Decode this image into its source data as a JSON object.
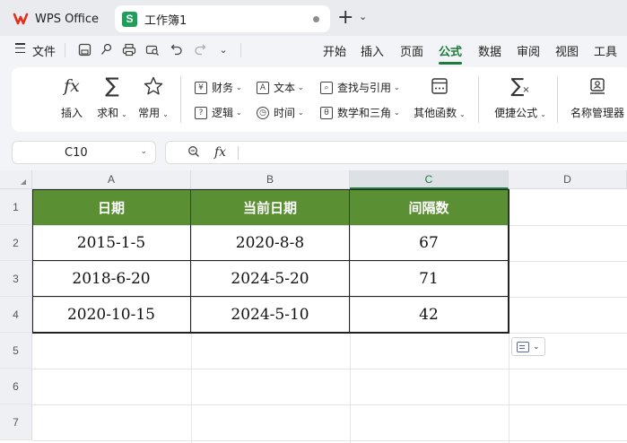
{
  "tabs": {
    "app_label": "WPS Office",
    "workbook_label": "工作簿1"
  },
  "menu": {
    "file_label": "文件",
    "ribbon_tabs": [
      "开始",
      "插入",
      "页面",
      "公式",
      "数据",
      "审阅",
      "视图",
      "工具"
    ],
    "active_tab": "公式"
  },
  "ribbon": {
    "insert_label": "插入",
    "sum_label": "求和",
    "common_label": "常用",
    "finance_label": "财务",
    "logic_label": "逻辑",
    "text_label": "文本",
    "time_label": "时间",
    "lookup_label": "查找与引用",
    "math_label": "数学和三角",
    "other_label": "其他函数",
    "quick_formula_label": "便捷公式",
    "name_manager_label": "名称管理器"
  },
  "formula_bar": {
    "name_box": "C10",
    "fx_symbol": "fx",
    "formula": ""
  },
  "sheet": {
    "columns": [
      "A",
      "B",
      "C",
      "D"
    ],
    "selected_column": "C",
    "rows": [
      "1",
      "2",
      "3",
      "4",
      "5",
      "6",
      "7"
    ],
    "headers": [
      "日期",
      "当前日期",
      "间隔数"
    ],
    "data": [
      [
        "2015-1-5",
        "2020-8-8",
        "67"
      ],
      [
        "2018-6-20",
        "2024-5-20",
        "71"
      ],
      [
        "2020-10-15",
        "2024-5-10",
        "42"
      ]
    ],
    "header_color": "#5a8f33"
  }
}
